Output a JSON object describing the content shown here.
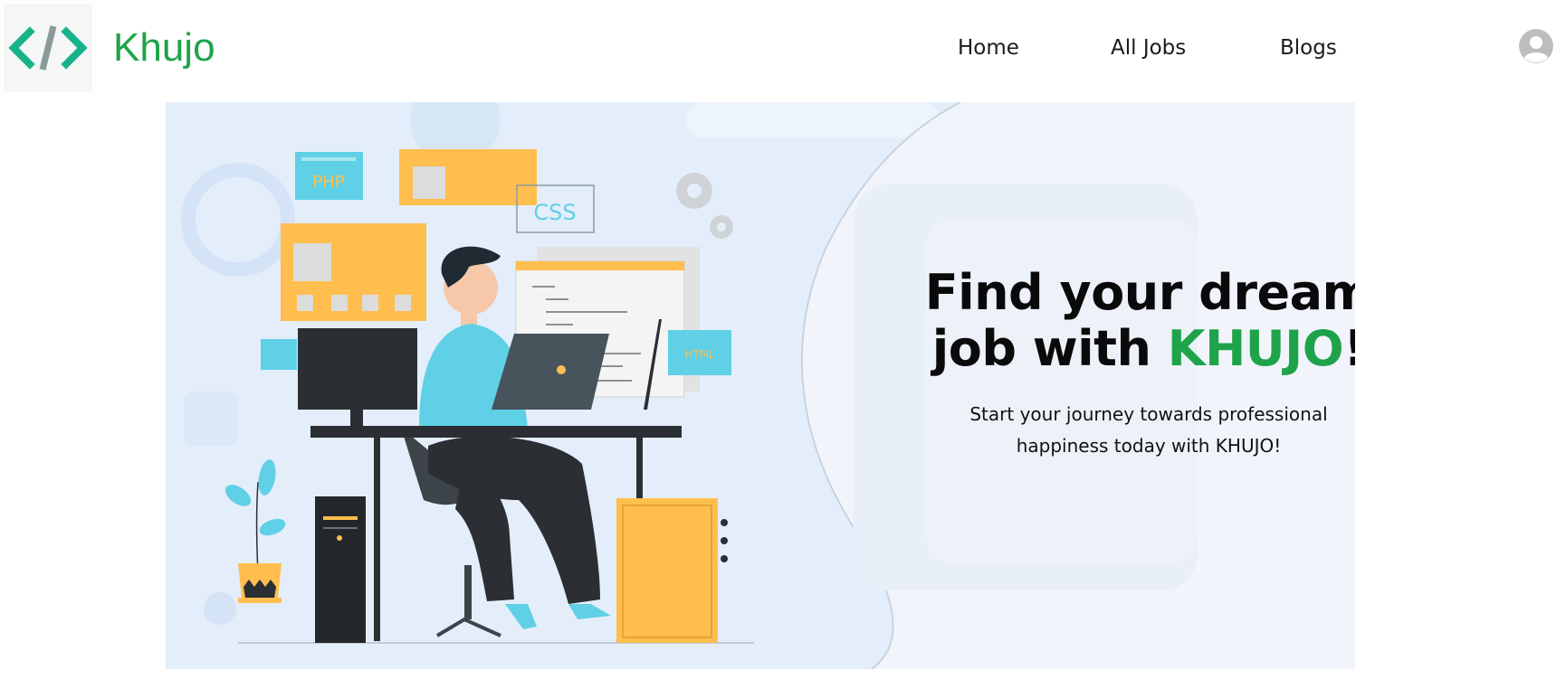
{
  "brand": {
    "name": "Khujo",
    "logo_icon": "code-brackets-icon"
  },
  "nav": {
    "items": [
      {
        "label": "Home"
      },
      {
        "label": "All Jobs"
      },
      {
        "label": "Blogs"
      }
    ],
    "profile_icon": "user-avatar-icon"
  },
  "hero": {
    "headline_part1": "Find your dream",
    "headline_part2": "job with ",
    "headline_brand": "KHUJO",
    "headline_end": "!",
    "subtext_line1": "Start your journey towards professional",
    "subtext_line2": "happiness today with KHUJO!",
    "illustration_labels": {
      "php": "PHP",
      "css": "CSS",
      "html": "HTML"
    }
  },
  "colors": {
    "brand_green": "#1fa34a",
    "logo_teal": "#17b28a",
    "logo_slash": "#8a9a9a",
    "hero_bg": "#e6f0fb",
    "accent_orange": "#ffbe4d",
    "accent_cyan": "#5fd0e6"
  }
}
